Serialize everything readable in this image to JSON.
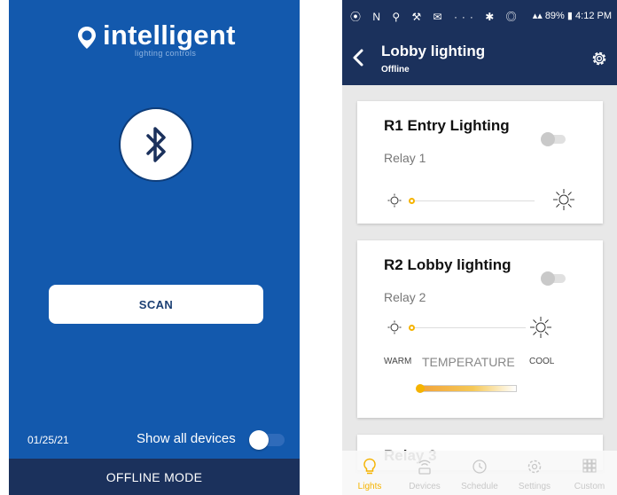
{
  "left": {
    "logo_text": "intelligent",
    "logo_sub": "lighting controls",
    "scan_label": "SCAN",
    "date": "01/25/21",
    "show_all_label": "Show all devices",
    "offline_label": "OFFLINE MODE",
    "show_all_enabled": false
  },
  "right": {
    "status_bar": {
      "battery": "89%",
      "time": "4:12 PM"
    },
    "header": {
      "title": "Lobby lighting",
      "subtitle": "Offline"
    },
    "cards": [
      {
        "title": "R1 Entry Lighting",
        "relay": "Relay 1",
        "on": false
      },
      {
        "title": "R2 Lobby lighting",
        "relay": "Relay 2",
        "on": false,
        "temp_warm": "WARM",
        "temp_title": "TEMPERATURE",
        "temp_cool": "COOL"
      },
      {
        "title": "Relay 3"
      }
    ],
    "nav": [
      {
        "label": "Lights",
        "icon": "bulb-icon",
        "active": true
      },
      {
        "label": "Devices",
        "icon": "devices-icon",
        "active": false
      },
      {
        "label": "Schedule",
        "icon": "clock-icon",
        "active": false
      },
      {
        "label": "Settings",
        "icon": "gear-icon",
        "active": false
      },
      {
        "label": "Custom",
        "icon": "grid-icon",
        "active": false
      }
    ]
  },
  "colors": {
    "left_bg": "#1359ad",
    "nav_dark": "#1b315c",
    "accent": "#f5b300"
  }
}
